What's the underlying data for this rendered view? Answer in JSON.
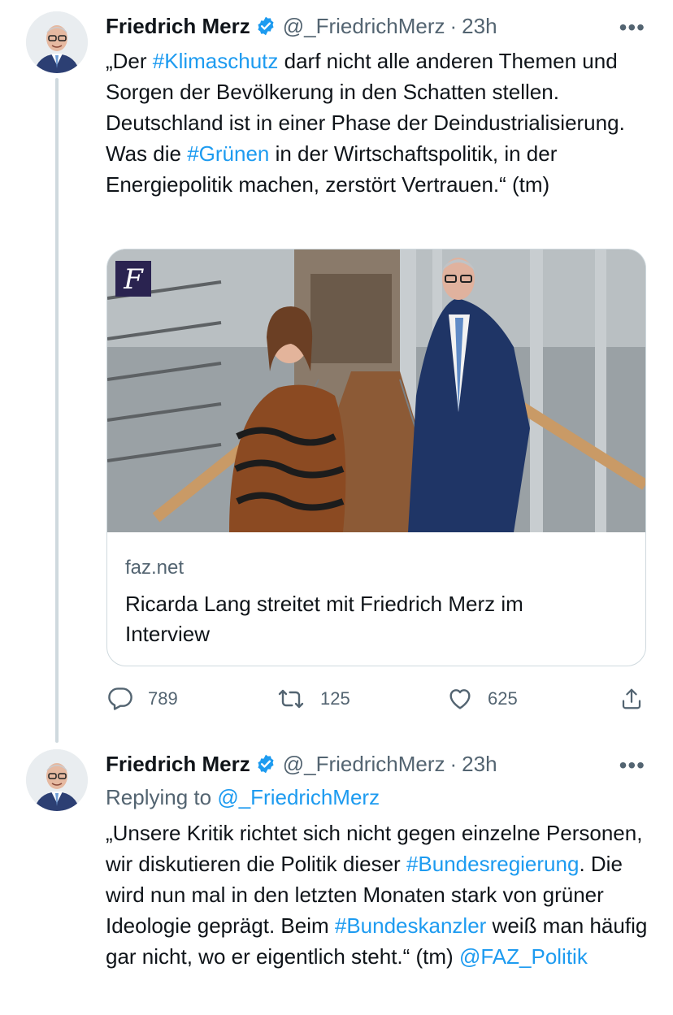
{
  "tweet1": {
    "author_name": "Friedrich Merz",
    "handle": "@_FriedrichMerz",
    "separator": "·",
    "time": "23h",
    "more": "•••",
    "text_parts": [
      "„Der ",
      "#Klimaschutz",
      " darf nicht alle anderen Themen und Sorgen der Bevölkerung in den Schatten stellen. Deutschland ist in einer Phase der Deindustrialisierung. Was die ",
      "#Grünen",
      " in der Wirtschaftspolitik, in der Energiepolitik machen, zerstört Vertrauen.“ (tm)"
    ],
    "card": {
      "domain": "faz.net",
      "title": "Ricarda Lang streitet mit Friedrich Merz im Interview",
      "logo_letter": "F"
    },
    "actions": {
      "replies": "789",
      "retweets": "125",
      "likes": "625"
    }
  },
  "tweet2": {
    "author_name": "Friedrich Merz",
    "handle": "@_FriedrichMerz",
    "separator": "·",
    "time": "23h",
    "more": "•••",
    "replying_prefix": "Replying to ",
    "replying_handle": "@_FriedrichMerz",
    "text_parts": [
      "„Unsere Kritik richtet sich nicht gegen einzelne Personen, wir diskutieren die Politik dieser ",
      "#Bundesregierung",
      ". Die wird nun mal in den letzten Monaten stark von grüner Ideologie geprägt. Beim ",
      "#Bundeskanzler",
      " weiß man häufig gar nicht, wo er eigentlich steht.“ (tm) ",
      "@FAZ_Politik"
    ]
  },
  "colors": {
    "link": "#1d9bf0",
    "text": "#0f1419",
    "secondary": "#536471",
    "border": "#cfd9de"
  },
  "icons": [
    "verified-badge-icon",
    "reply-icon",
    "retweet-icon",
    "like-icon",
    "share-icon",
    "more-icon"
  ]
}
